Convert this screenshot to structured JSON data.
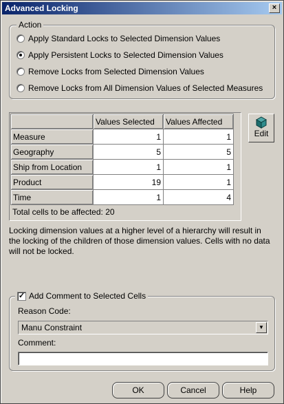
{
  "window": {
    "title": "Advanced Locking",
    "close_label": "×"
  },
  "action": {
    "legend": "Action",
    "options": [
      {
        "label": "Apply Standard Locks to Selected Dimension Values",
        "checked": false
      },
      {
        "label": "Apply Persistent Locks to Selected Dimension Values",
        "checked": true
      },
      {
        "label": "Remove Locks from Selected Dimension Values",
        "checked": false
      },
      {
        "label": "Remove Locks from All Dimension Values of Selected Measures",
        "checked": false
      }
    ]
  },
  "table": {
    "headers": [
      "",
      "Values Selected",
      "Values Affected"
    ],
    "rows": [
      {
        "name": "Measure",
        "selected": "1",
        "affected": "1"
      },
      {
        "name": "Geography",
        "selected": "5",
        "affected": "5"
      },
      {
        "name": "Ship from Location",
        "selected": "1",
        "affected": "1"
      },
      {
        "name": "Product",
        "selected": "19",
        "affected": "1"
      },
      {
        "name": "Time",
        "selected": "1",
        "affected": "4"
      }
    ],
    "total": "Total cells to be affected: 20"
  },
  "edit_button": {
    "label": "Edit",
    "icon": "edit-cube-icon"
  },
  "info_text": "Locking dimension values at a higher level of a hierarchy will result in the locking of the children of those dimension values.  Cells with no data will not be locked.",
  "comment": {
    "checkbox_label": "Add Comment to Selected Cells",
    "checked": true,
    "reason_label": "Reason Code:",
    "reason_value": "Manu Constraint",
    "comment_label": "Comment:",
    "comment_value": ""
  },
  "buttons": {
    "ok": "OK",
    "cancel": "Cancel",
    "help": "Help"
  }
}
